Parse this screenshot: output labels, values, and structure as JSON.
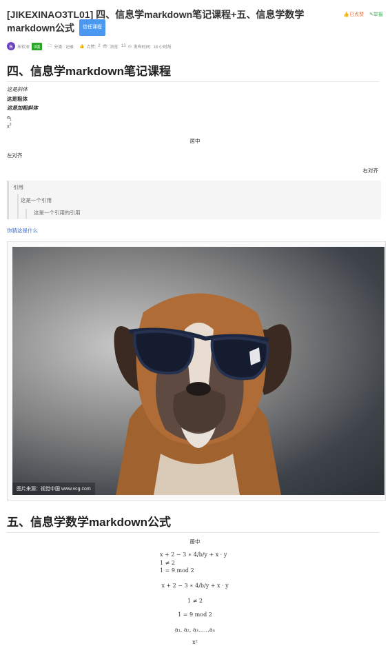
{
  "header": {
    "title": "[JIKEXINAO3TL01] 四、信息学markdown笔记课程+五、信息学数学markdown公式",
    "course_badge": "信任课程",
    "liked_label": "已点赞",
    "report_label": "举报"
  },
  "meta": {
    "avatar_letter": "朱",
    "author": "朱钦深",
    "level": "0级",
    "category_label": "分类:",
    "category": "记录",
    "likes_label": "点赞:",
    "likes": "2",
    "views_label": "浏览:",
    "views": "13",
    "publish_label": "发布时间:",
    "publish": "18 小时前"
  },
  "section1": {
    "heading": "四、信息学markdown笔记课程",
    "italic": "这是斜体",
    "bold": "这是粗体",
    "bold_italic": "这是加粗斜体",
    "sub_base": "a",
    "sub_index": "1",
    "sup_base": "x",
    "sup_index": "2",
    "center": "居中",
    "left": "左对齐",
    "right": "右对齐",
    "quote1": "引用",
    "quote2": "这是一个引用",
    "quote3": "这是一个引用的引用",
    "link": "你猜这是什么"
  },
  "image": {
    "watermark": "图片来源：视觉中国 www.vcg.com"
  },
  "section2": {
    "heading": "五、信息学数学markdown公式",
    "center": "居中",
    "eq1": "x + 2 − 3 ∗ 4/b/y + x · y",
    "eq2": "1 ≠ 2",
    "eq3": "1 = 9 mod 2",
    "eq4": "x + 2 − 3 ∗ 4/b/y + x · y",
    "eq5": "1 ≠ 2",
    "eq6": "1 = 9 mod 2",
    "eq7": "a₁, a₂, a₃……aₙ",
    "eq8": "x²"
  }
}
